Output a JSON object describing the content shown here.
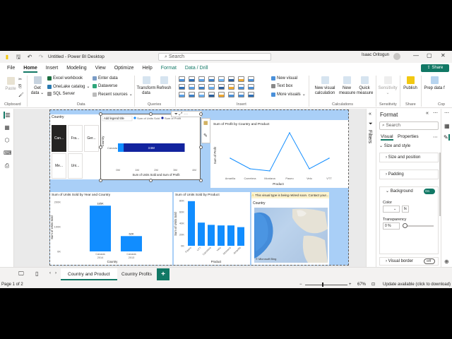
{
  "window": {
    "title": "Untitled - Power BI Desktop",
    "search_placeholder": "Search",
    "user": "Isaac Oritogun"
  },
  "menu": {
    "items": [
      "File",
      "Home",
      "Insert",
      "Modeling",
      "View",
      "Optimize",
      "Help",
      "Format",
      "Data / Drill"
    ],
    "active": "Home",
    "share": "Share"
  },
  "ribbon": {
    "clipboard": {
      "paste": "Paste",
      "label": "Clipboard"
    },
    "data": {
      "get_data": "Get data",
      "excel": "Excel workbook",
      "onelake": "OneLake catalog",
      "sql": "SQL Server",
      "enter": "Enter data",
      "dataverse": "Dataverse",
      "recent": "Recent sources",
      "label": "Data"
    },
    "queries": {
      "transform": "Transform data",
      "refresh": "Refresh",
      "label": "Queries"
    },
    "insert": {
      "new_visual": "New visual",
      "text_box": "Text box",
      "more_visuals": "More visuals",
      "label": "Insert"
    },
    "calculations": {
      "new_calc": "New visual calculation",
      "new_measure": "New measure",
      "quick_measure": "Quick measure",
      "label": "Calculations"
    },
    "sensitivity": {
      "btn": "Sensitivity",
      "label": "Sensitivity"
    },
    "share": {
      "publish": "Publish",
      "label": "Share"
    },
    "copilot": {
      "prep": "Prep data f",
      "label": "Cop"
    }
  },
  "visuals": {
    "slicer": {
      "title": "Country",
      "items": [
        "Can...",
        "Fra...",
        "Ger...",
        "Me...",
        "Uni..."
      ]
    },
    "bar_h": {
      "legend_title": "Add legend title",
      "legend": [
        "Sum of Units Sold",
        "Sum of Profit"
      ],
      "category": "Canada",
      "value_label": "3.5M",
      "xticks": [
        "0M",
        "1M",
        "2M",
        "3M",
        "4M"
      ],
      "xlabel": "Sum of Units Sold and Sum of Profit",
      "ylabel": "Country"
    },
    "line": {
      "title": "Sum of Profit by Country and Product",
      "xlabel": "Product",
      "ylabel": "Sum of Profit",
      "categories": [
        "Amarilla",
        "Carretera",
        "Montana",
        "Paseo",
        "Velo",
        "VTT"
      ],
      "values": [
        0.4,
        0.15,
        0.1,
        1.0,
        0.15,
        0.4
      ]
    },
    "col_year": {
      "title": "Sum of Units Sold by Year and Country",
      "ylabel": "Sum of Units Sold",
      "xlabel": "Country",
      "yticks": [
        "200K",
        "100K",
        "0K"
      ],
      "bars": [
        {
          "label": "Canada 2014",
          "value": 185,
          "text": "185K"
        },
        {
          "label": "Canada 2013",
          "value": 62,
          "text": "62K"
        }
      ]
    },
    "col_product": {
      "title": "Sum of Units Sold by Product",
      "ylabel": "Sum of Units Sold",
      "xlabel": "Product",
      "yticks": [
        "80K",
        "60K",
        "40K",
        "20K",
        "0K"
      ],
      "categories": [
        "Paseo",
        "VTT",
        "Carretera",
        "Velo",
        "Montana",
        "Amarilla"
      ],
      "values": [
        79,
        41,
        37,
        36,
        36,
        33
      ]
    },
    "map": {
      "warning": "This visual type is being retired soon. Contact your...",
      "title": "Country",
      "credit": "© Microsoft Bing"
    }
  },
  "chart_data": [
    {
      "type": "bar",
      "title": "",
      "categories": [
        "Canada"
      ],
      "series": [
        {
          "name": "Sum of Units Sold",
          "values": [
            3500000
          ]
        },
        {
          "name": "Sum of Profit",
          "values": [
            300000
          ]
        }
      ],
      "xlabel": "Sum of Units Sold and Sum of Profit",
      "ylabel": "Country",
      "xlim": [
        0,
        4000000
      ]
    },
    {
      "type": "line",
      "title": "Sum of Profit by Country and Product",
      "categories": [
        "Amarilla",
        "Carretera",
        "Montana",
        "Paseo",
        "Velo",
        "VTT"
      ],
      "values": [
        0.4,
        0.15,
        0.1,
        1.0,
        0.15,
        0.4
      ],
      "xlabel": "Product",
      "ylabel": "Sum of Profit"
    },
    {
      "type": "bar",
      "title": "Sum of Units Sold by Year and Country",
      "categories": [
        "Canada 2014",
        "Canada 2013"
      ],
      "values": [
        185000,
        62000
      ],
      "xlabel": "Country",
      "ylabel": "Sum of Units Sold",
      "ylim": [
        0,
        200000
      ]
    },
    {
      "type": "bar",
      "title": "Sum of Units Sold by Product",
      "categories": [
        "Paseo",
        "VTT",
        "Carretera",
        "Velo",
        "Montana",
        "Amarilla"
      ],
      "values": [
        79000,
        41000,
        37000,
        36000,
        36000,
        33000
      ],
      "xlabel": "Product",
      "ylabel": "Sum of Units Sold",
      "ylim": [
        0,
        80000
      ]
    }
  ],
  "format_pane": {
    "title": "Format",
    "search_placeholder": "Search",
    "tabs": [
      "Visual",
      "Properties"
    ],
    "section": "Size and style",
    "items": [
      "Size and position",
      "Padding",
      "Background",
      "Visual border"
    ],
    "color_label": "Color",
    "transparency_label": "Transparency",
    "transparency_value": "0 %",
    "toggle_on": "On",
    "toggle_off": "Off",
    "filters_label": "Filters"
  },
  "pages": {
    "tabs": [
      "Country and Product",
      "Country Profits"
    ],
    "active": "Country and Product",
    "add": "+"
  },
  "status": {
    "page": "Page 1 of 2",
    "zoom": "67%",
    "update": "Update available (click to download)"
  },
  "colors": {
    "accent": "#117865",
    "bar": "#118dff",
    "dark_bar": "#12239e",
    "canvas": "#a9cff7"
  }
}
